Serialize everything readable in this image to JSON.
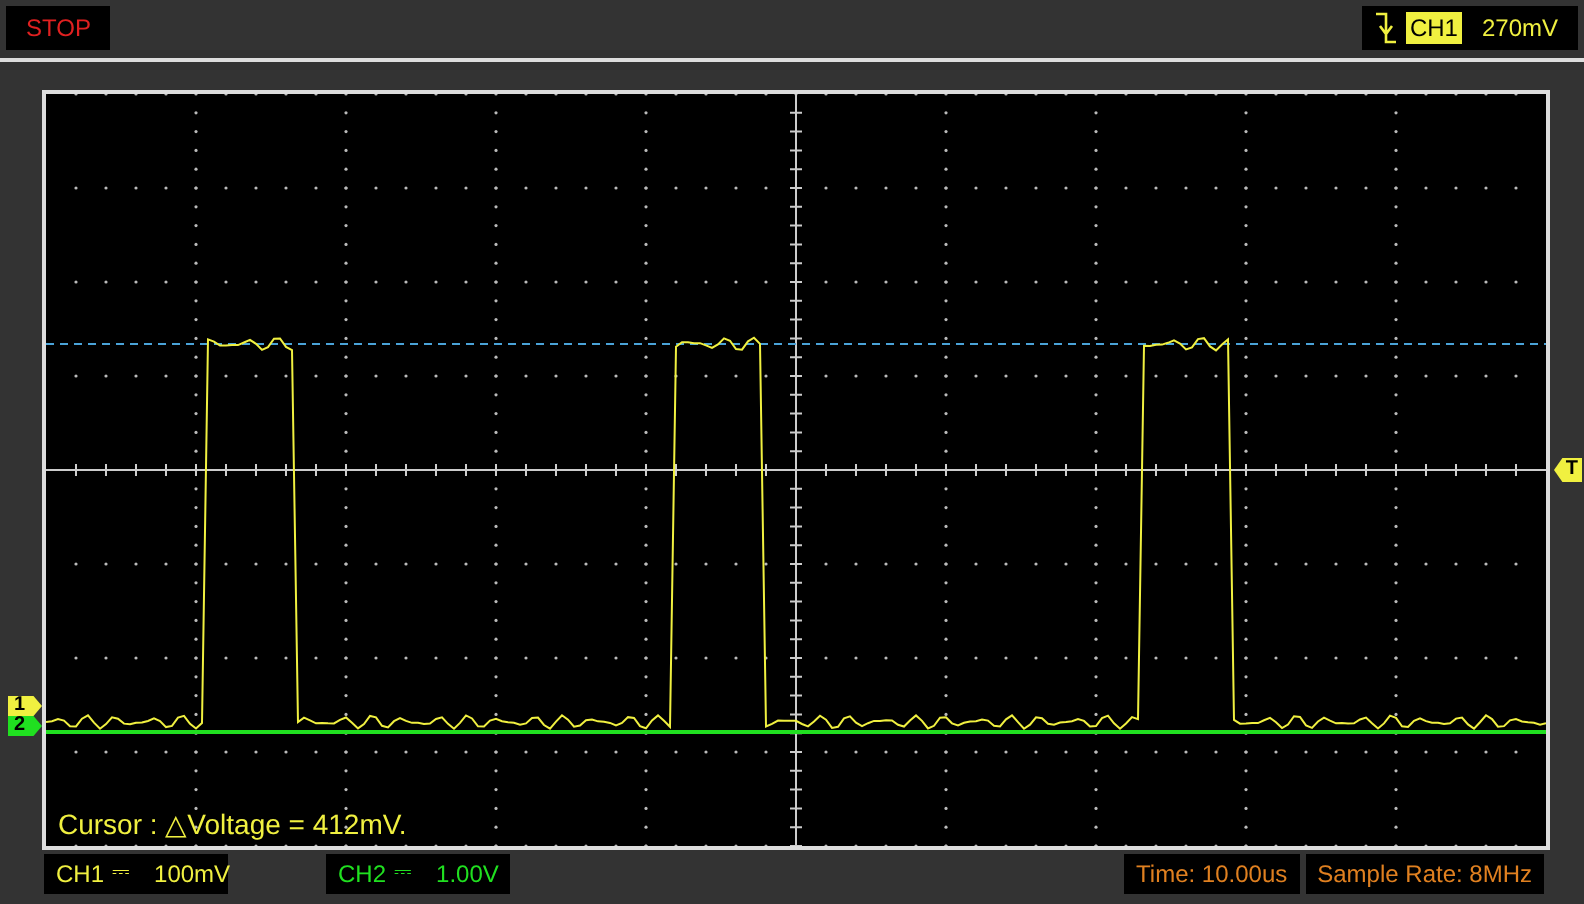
{
  "status": "STOP",
  "trigger": {
    "channel": "CH1",
    "level": "270mV"
  },
  "markers": {
    "ch1": "1",
    "ch2": "2",
    "trigger": "T"
  },
  "cursor_readout": "Cursor : △Voltage = 412mV.",
  "channels": [
    {
      "label": "CH1",
      "coupling": "⎓",
      "scale": "100mV",
      "color": "#f0f040"
    },
    {
      "label": "CH2",
      "coupling": "⎓",
      "scale": "1.00V",
      "color": "#20e020"
    }
  ],
  "timebase": {
    "time": "Time: 10.00us",
    "sample_rate": "Sample Rate: 8MHz"
  }
}
